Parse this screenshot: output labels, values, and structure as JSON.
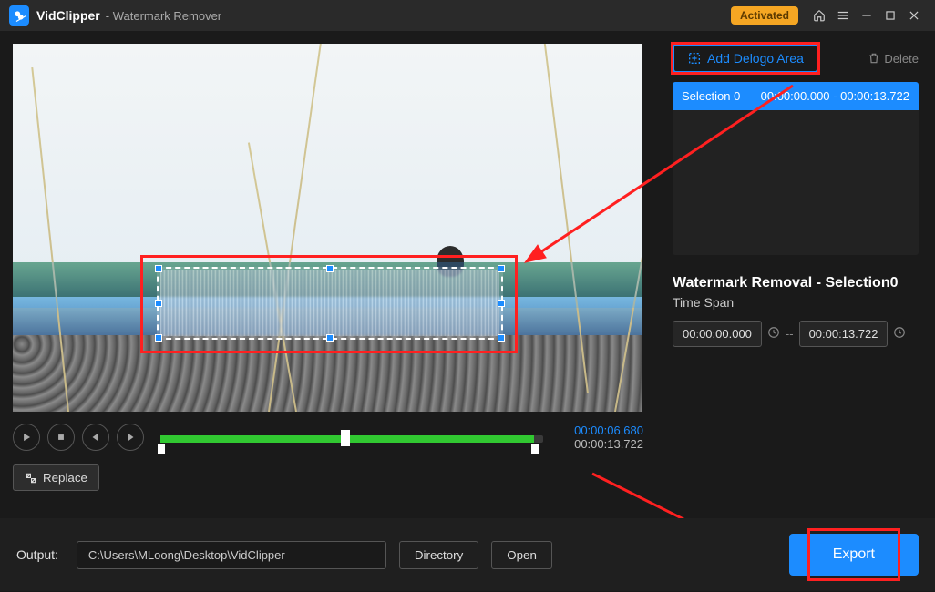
{
  "titlebar": {
    "app_name": "VidClipper",
    "mode": "- Watermark Remover",
    "activated": "Activated"
  },
  "video": {
    "current_time": "00:00:06.680",
    "total_time": "00:00:13.722",
    "replace_label": "Replace"
  },
  "right": {
    "add_label": "Add Delogo Area",
    "delete_label": "Delete",
    "selection_list": [
      {
        "name": "Selection 0",
        "span": "00:00:00.000 - 00:00:13.722"
      }
    ],
    "section_title": "Watermark Removal - Selection0",
    "section_sub": "Time Span",
    "time_start": "00:00:00.000",
    "time_end": "00:00:13.722"
  },
  "bottom": {
    "output_label": "Output:",
    "output_path": "C:\\Users\\MLoong\\Desktop\\VidClipper",
    "directory_label": "Directory",
    "open_label": "Open",
    "export_label": "Export"
  }
}
